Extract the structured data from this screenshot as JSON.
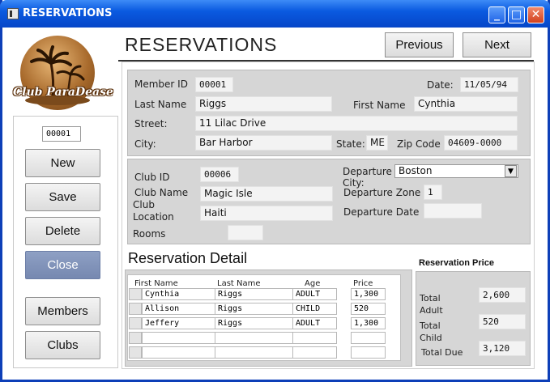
{
  "window": {
    "title": "RESERVATIONS",
    "controls": {
      "minimize": "_",
      "maximize": "□",
      "close": "✕"
    }
  },
  "logo": {
    "text": "Club ParaDease"
  },
  "sidebar": {
    "record_id": "00001",
    "buttons": {
      "new": "New",
      "save": "Save",
      "delete": "Delete",
      "close": "Close",
      "members": "Members",
      "clubs": "Clubs"
    }
  },
  "header": {
    "title": "RESERVATIONS",
    "previous": "Previous",
    "next": "Next"
  },
  "member": {
    "member_id_label": "Member ID",
    "member_id": "00001",
    "date_label": "Date:",
    "date": "11/05/94",
    "last_name_label": "Last Name",
    "last_name": "Riggs",
    "first_name_label": "First Name",
    "first_name": "Cynthia",
    "street_label": "Street:",
    "street": "11 Lilac Drive",
    "city_label": "City:",
    "city": "Bar Harbor",
    "state_label": "State:",
    "state": "ME",
    "zip_label": "Zip Code",
    "zip": "04609-0000"
  },
  "club": {
    "club_id_label": "Club ID",
    "club_id": "00006",
    "club_name_label": "Club Name",
    "club_name": "Magic Isle",
    "club_location_label": "Club Location",
    "club_location": "Haiti",
    "rooms_label": "Rooms",
    "rooms": "",
    "departure_city_label": "Departure City:",
    "departure_city": "Boston",
    "departure_zone_label": "Departure Zone",
    "departure_zone": "1",
    "departure_date_label": "Departure Date",
    "departure_date": ""
  },
  "reservation_detail": {
    "title": "Reservation Detail",
    "columns": [
      "First Name",
      "Last Name",
      "Age",
      "Price"
    ],
    "rows": [
      [
        "Cynthia",
        "Riggs",
        "ADULT",
        "1,300"
      ],
      [
        "Allison",
        "Riggs",
        "CHILD",
        "520"
      ],
      [
        "Jeffery",
        "Riggs",
        "ADULT",
        "1,300"
      ],
      [
        "",
        "",
        "",
        ""
      ],
      [
        "",
        "",
        "",
        ""
      ]
    ]
  },
  "reservation_price": {
    "title": "Reservation Price",
    "total_adult_label": "Total Adult",
    "total_adult": "2,600",
    "total_child_label": "Total Child",
    "total_child": "520",
    "total_due_label": "Total Due",
    "total_due": "3,120"
  },
  "colors": {
    "titlebar": "#0a5ae0",
    "panel": "#d6d6d6",
    "close_button_disabled": "#7688b0"
  }
}
